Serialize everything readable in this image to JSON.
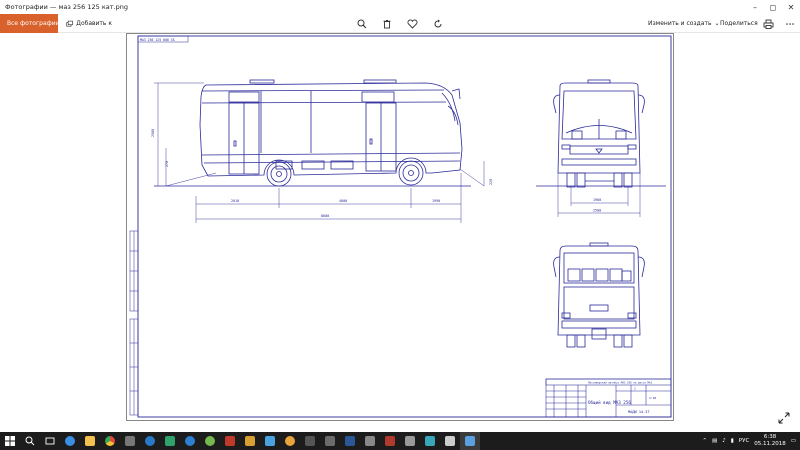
{
  "window": {
    "title": "Фотографии — маз 256 125 кат.png",
    "controls": [
      "minimize",
      "maximize",
      "close"
    ]
  },
  "toolbar": {
    "all_photos_label": "Все фотографии",
    "add_to_label": "Добавить к",
    "edit_create_label": "Изменить и создать",
    "share_label": "Поделиться",
    "icons": [
      "zoom-icon",
      "delete-icon",
      "favorite-icon",
      "rotate-icon",
      "print-icon",
      "more-icon"
    ]
  },
  "drawing": {
    "stamp_text": "МАЗ 256 125 000 СБ",
    "dims": {
      "overall_length": "8000",
      "front_overhang": "2010",
      "wheelbase": "4000",
      "rear_overhang": "1990",
      "height": "2980",
      "ground_clear_front": "270",
      "ground_clear_rear": "220",
      "track_front": "1960",
      "width": "2500"
    },
    "title_block": {
      "notes": "Пассажирский автобус МАЗ 256 на шасси МАЗ",
      "name": "Общий вид МАЗ 256",
      "code": "МАДИ 14-3Т",
      "sheet": "1",
      "scale": "1:20"
    }
  },
  "taskbar": {
    "lang": "РУС",
    "time": "6:38",
    "date": "05.11.2018"
  },
  "colors": {
    "accent": "#d9612b",
    "drawing_line": "#2a2a9a",
    "taskbar": "#1c1c1c"
  }
}
